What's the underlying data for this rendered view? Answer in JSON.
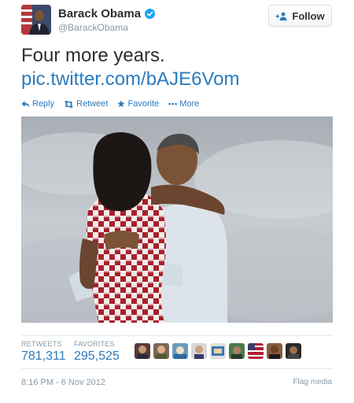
{
  "author": {
    "name": "Barack Obama",
    "handle": "@BarackObama",
    "verified": true
  },
  "follow_button": {
    "label": "Follow"
  },
  "tweet": {
    "text": "Four more years.",
    "link": "pic.twitter.com/bAJE6Vom"
  },
  "actions": [
    {
      "label": "Reply",
      "icon": "reply-icon"
    },
    {
      "label": "Retweet",
      "icon": "retweet-icon"
    },
    {
      "label": "Favorite",
      "icon": "star-icon"
    },
    {
      "label": "More",
      "icon": "more-icon"
    }
  ],
  "stats": {
    "retweets_label": "RETWEETS",
    "retweets_value": "781,311",
    "favorites_label": "FAVORITES",
    "favorites_value": "295,525"
  },
  "footer": {
    "timestamp": "8:16 PM - 6 Nov 2012",
    "flag_label": "Flag media"
  },
  "colors": {
    "link": "#2a7bbd",
    "muted": "#8899a6",
    "verified": "#1da1f2"
  }
}
